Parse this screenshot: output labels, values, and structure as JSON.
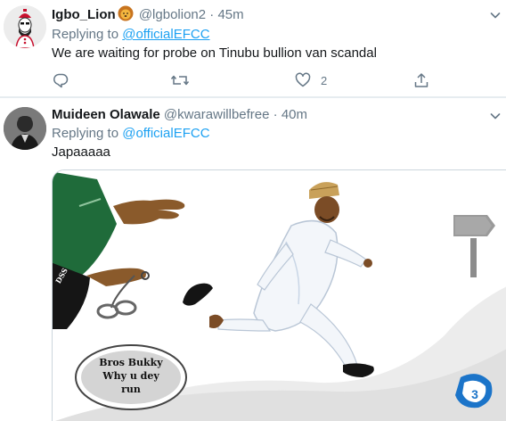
{
  "tweets": [
    {
      "display_name": "Igbo_Lion",
      "handle": "@lgbolion2",
      "separator": "·",
      "time": "45m",
      "replying_prefix": "Replying to",
      "replying_to": "@officialEFCC",
      "text": "We are waiting for probe on Tinubu bullion van scandal",
      "reply_count": "",
      "retweet_count": "",
      "like_count": "2"
    },
    {
      "display_name": "Muideen Olawale",
      "handle": "@kwarawillbefree",
      "separator": "·",
      "time": "40m",
      "replying_prefix": "Replying to",
      "replying_to": "@officialEFCC",
      "text": "Japaaaaa",
      "media": {
        "bubble_text": [
          "Bros Bukky",
          "Why u dey",
          "run"
        ],
        "sleeve_badge": "DSS",
        "watermark": "3"
      }
    }
  ],
  "icons": {
    "caret": "chevron-down-icon",
    "reply": "reply-icon",
    "retweet": "retweet-icon",
    "like": "heart-icon",
    "share": "share-icon",
    "name_emoji": "lion-face-emoji"
  },
  "colors": {
    "link": "#1da1f2",
    "secondary_text": "#657786",
    "primary_text": "#14171a",
    "border": "#e6ecf0"
  }
}
